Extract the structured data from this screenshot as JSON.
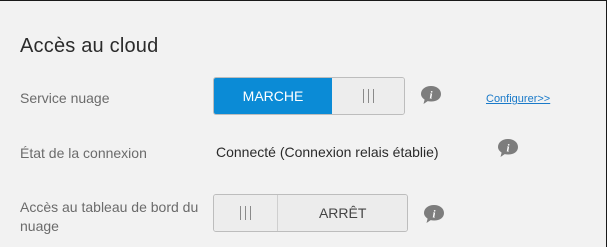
{
  "section": {
    "title": "Accès au cloud"
  },
  "rows": {
    "cloud_service": {
      "label": "Service nuage",
      "toggle_on_label": "MARCHE",
      "toggle_state": "on",
      "configure_link": "Configurer>>"
    },
    "connection_status": {
      "label": "État de la connexion",
      "value": "Connecté (Connexion relais établie)"
    },
    "dashboard_access": {
      "label": "Accès au tableau de bord du nuage",
      "toggle_off_label": "ARRÊT",
      "toggle_state": "off"
    }
  },
  "icons": {
    "info": "info-icon"
  },
  "colors": {
    "accent": "#0b8bd6",
    "panel_bg": "#f2f2f2",
    "link": "#1a7ac9"
  }
}
